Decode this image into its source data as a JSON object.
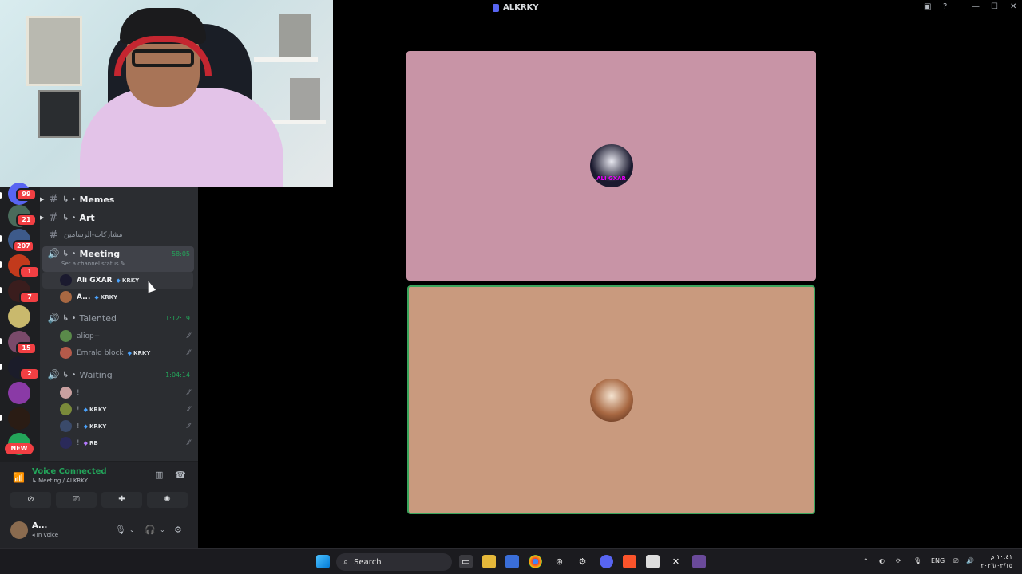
{
  "window": {
    "title": "ALKRKY"
  },
  "servers": {
    "badges": [
      "99",
      "21",
      "207",
      "1",
      "7",
      "15",
      "2"
    ],
    "new_label": "NEW"
  },
  "channels": {
    "memes": "Memes",
    "art": "Art",
    "arabic": "مشاركات-الرسامين",
    "meeting": {
      "name": "Meeting",
      "timer": "58:05",
      "status": "Set a channel status"
    },
    "talented": {
      "name": "Talented",
      "timer": "1:12:19"
    },
    "waiting": {
      "name": "Waiting",
      "timer": "1:04:14"
    }
  },
  "members": {
    "meeting": [
      {
        "name": "Ali GXAR",
        "tag": "KRKY"
      },
      {
        "name": "A...",
        "tag": "KRKY"
      }
    ],
    "talented": [
      {
        "name": "aliop+",
        "tag": ""
      },
      {
        "name": "Emrald block",
        "tag": "KRKY"
      }
    ],
    "waiting": [
      {
        "name": "!",
        "tag": ""
      },
      {
        "name": "!",
        "tag": "KRKY"
      },
      {
        "name": "!",
        "tag": "KRKY"
      },
      {
        "name": "!",
        "tag": "RB"
      }
    ]
  },
  "voice": {
    "title": "Voice Connected",
    "subtitle": "Meeting / ALKRKY"
  },
  "user": {
    "name": "A...",
    "status": "In voice"
  },
  "stage": {
    "tile1_label": "ALI GXAR"
  },
  "taskbar": {
    "search": "Search",
    "lang": "ENG",
    "time": "١٠:٤١ م",
    "date": "٢٠٢٦/٠٣/١٥"
  },
  "colors": {
    "accent": "#5865f2",
    "voice_green": "#23a55a",
    "tile1_bg": "#c894a6",
    "tile2_bg": "#c99a7e",
    "speaking_border": "#3ba55d"
  }
}
